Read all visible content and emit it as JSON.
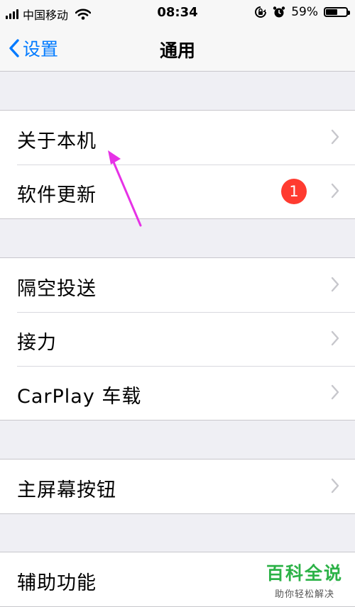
{
  "status_bar": {
    "carrier": "中国移动",
    "time": "08:34",
    "battery_percent": "59%",
    "icons": [
      "signal-icon",
      "wifi-icon",
      "rotation-lock-icon",
      "alarm-icon",
      "battery-icon"
    ]
  },
  "nav": {
    "back_label": "设置",
    "title": "通用"
  },
  "colors": {
    "accent": "#007aff",
    "badge": "#ff3b30",
    "arrow": "#e632e6",
    "watermark": "#2cb247"
  },
  "groups": [
    {
      "items": [
        {
          "label": "关于本机"
        },
        {
          "label": "软件更新",
          "badge": "1"
        }
      ]
    },
    {
      "items": [
        {
          "label": "隔空投送"
        },
        {
          "label": "接力"
        },
        {
          "label": "CarPlay 车载"
        }
      ]
    },
    {
      "items": [
        {
          "label": "主屏幕按钮"
        }
      ]
    },
    {
      "items": [
        {
          "label": "辅助功能"
        }
      ]
    }
  ],
  "watermark": {
    "title": "百科全说",
    "subtitle": "助你轻松解决"
  }
}
